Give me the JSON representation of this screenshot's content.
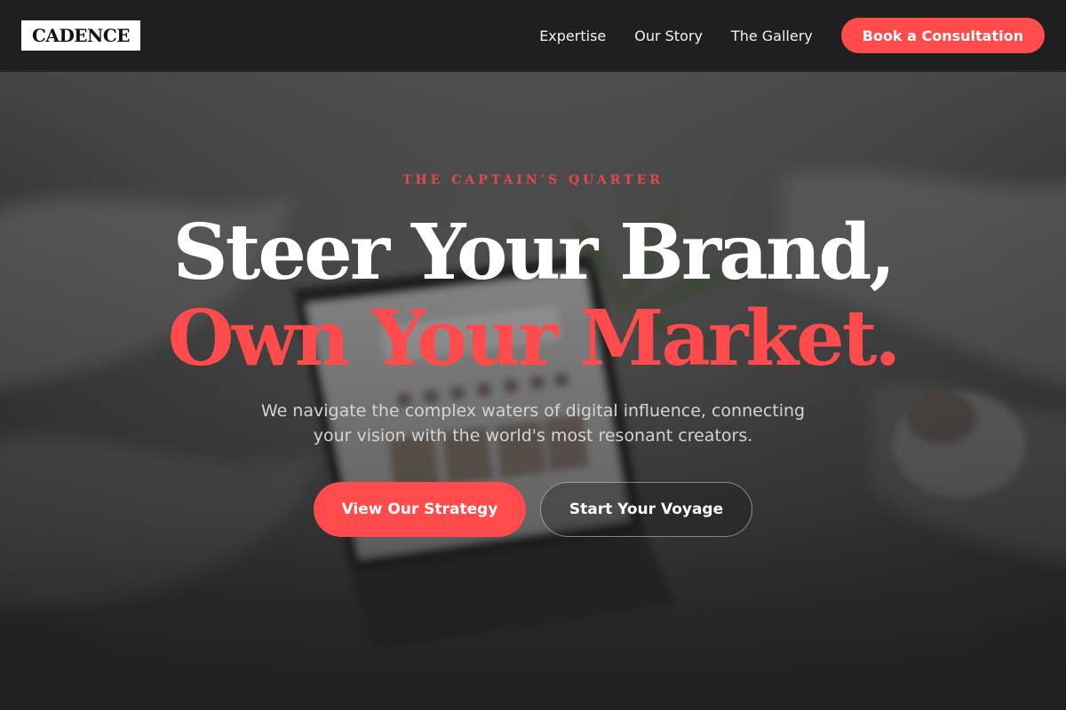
{
  "header": {
    "logo_text": "CADENCE",
    "nav_links": [
      "Expertise",
      "Our Story",
      "The Gallery"
    ],
    "cta_label": "Book a Consultation"
  },
  "hero": {
    "eyebrow": "THE CAPTAIN'S QUARTER",
    "headline_line_1": "Steer Your Brand,",
    "headline_line_2": "Own Your Market.",
    "subtitle": "We navigate the complex waters of digital influence, connecting your vision with the world's most resonant creators.",
    "primary_button": "View Our Strategy",
    "secondary_button": "Start Your Voyage",
    "background_image": "blurred-laptop-on-bed-photo"
  },
  "colors": {
    "accent": "#ff4b4b",
    "eyebrow": "#e8474a",
    "header_bg": "#1f1f1f",
    "text_light": "#ffffff"
  }
}
